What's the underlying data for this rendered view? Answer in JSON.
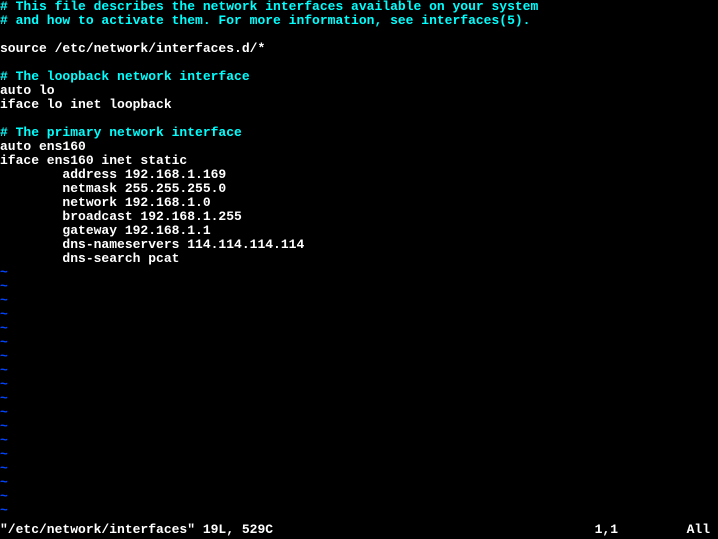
{
  "file": {
    "comment1": "# This file describes the network interfaces available on your system",
    "comment2": "# and how to activate them. For more information, see interfaces(5).",
    "blank1": "",
    "source": "source /etc/network/interfaces.d/*",
    "blank2": "",
    "comment3": "# The loopback network interface",
    "auto_lo": "auto lo",
    "iface_lo": "iface lo inet loopback",
    "blank3": "",
    "comment4": "# The primary network interface",
    "auto_ens": "auto ens160",
    "iface_ens": "iface ens160 inet static",
    "address": "        address 192.168.1.169",
    "netmask": "        netmask 255.255.255.0",
    "network": "        network 192.168.1.0",
    "broadcast": "        broadcast 192.168.1.255",
    "gateway": "        gateway 192.168.1.1",
    "dns_ns": "        dns-nameservers 114.114.114.114",
    "dns_search": "        dns-search pcat"
  },
  "tilde": "~",
  "status": {
    "filename": "\"/etc/network/interfaces\" 19L, 529C",
    "position": "1,1",
    "scroll": "All"
  }
}
